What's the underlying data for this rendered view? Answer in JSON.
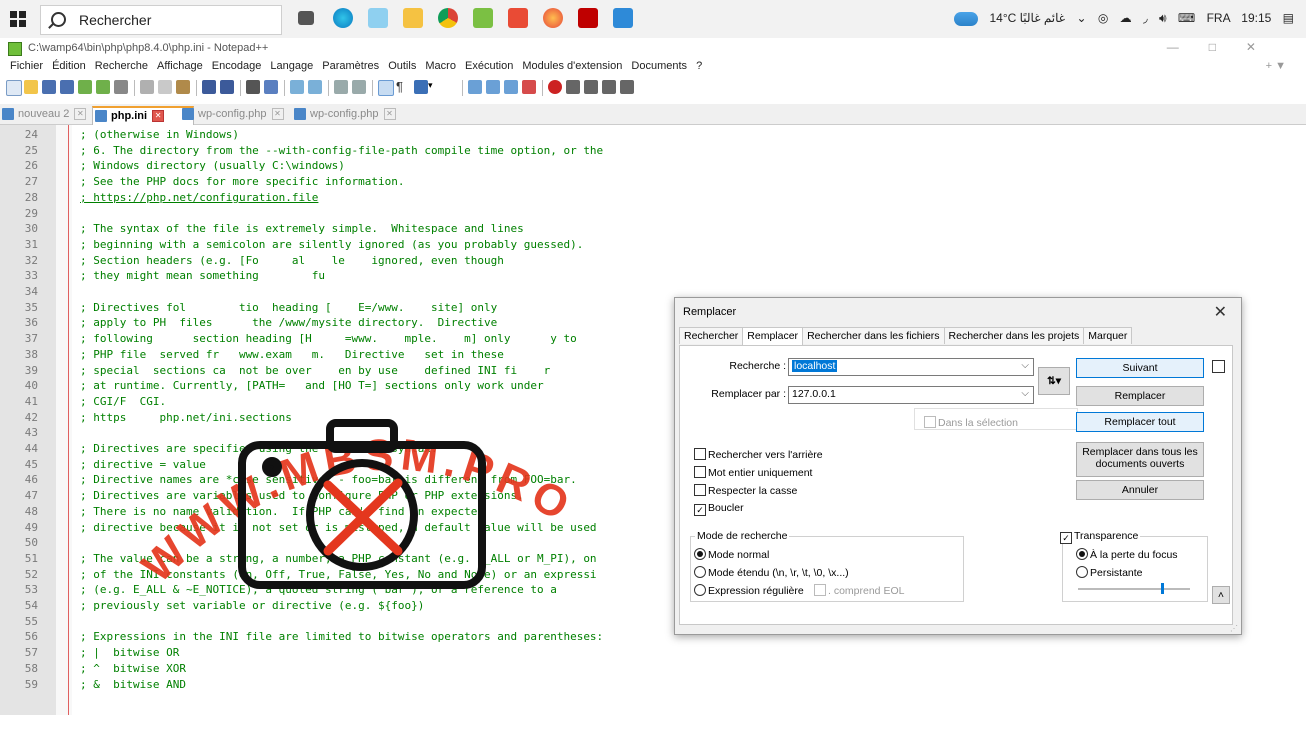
{
  "taskbar": {
    "search_placeholder": "Rechercher",
    "weather": "14°C غائم غالبًا",
    "language": "FRA",
    "time": "19:15"
  },
  "window": {
    "title": "C:\\wamp64\\bin\\php\\php8.4.0\\php.ini - Notepad++"
  },
  "menu": {
    "items": [
      "Fichier",
      "Édition",
      "Recherche",
      "Affichage",
      "Encodage",
      "Langage",
      "Paramètres",
      "Outils",
      "Macro",
      "Exécution",
      "Modules d'extension",
      "Documents",
      "?"
    ],
    "right": "+ ▼"
  },
  "tabs": [
    {
      "label": "nouveau 2"
    },
    {
      "label": "php.ini"
    },
    {
      "label": "wp-config.php"
    },
    {
      "label": "wp-config.php"
    }
  ],
  "editor": {
    "lines": [
      {
        "n": "24",
        "text": "; (otherwise in Windows)"
      },
      {
        "n": "25",
        "text": "; 6. The directory from the --with-config-file-path compile time option, or the"
      },
      {
        "n": "26",
        "text": "; Windows directory (usually C:\\windows)"
      },
      {
        "n": "27",
        "text": "; See the PHP docs for more specific information."
      },
      {
        "n": "28",
        "text": "; https://php.net/configuration.file"
      },
      {
        "n": "29",
        "text": ""
      },
      {
        "n": "30",
        "text": "; The syntax of the file is extremely simple.  Whitespace and lines"
      },
      {
        "n": "31",
        "text": "; beginning with a semicolon are silently ignored (as you probably guessed)."
      },
      {
        "n": "32",
        "text": "; Section headers (e.g. [Fo     al    le    ignored, even though"
      },
      {
        "n": "33",
        "text": "; they might mean something        fu"
      },
      {
        "n": "34",
        "text": ""
      },
      {
        "n": "35",
        "text": "; Directives fol        tio  heading [    E=/www.    site] only"
      },
      {
        "n": "36",
        "text": "; apply to PH  files      the /www/mysite directory.  Directive"
      },
      {
        "n": "37",
        "text": "; following      section heading [H     =www.    mple.    m] only      y to"
      },
      {
        "n": "38",
        "text": "; PHP file  served fr   www.exam   m.   Directive   set in these"
      },
      {
        "n": "39",
        "text": "; special  sections ca  not be over    en by use    defined INI fi    r"
      },
      {
        "n": "40",
        "text": "; at runtime. Currently, [PATH=   and [HO T=] sections only work under"
      },
      {
        "n": "41",
        "text": "; CGI/F  CGI."
      },
      {
        "n": "42",
        "text": "; https     php.net/ini.sections"
      },
      {
        "n": "43",
        "text": ""
      },
      {
        "n": "44",
        "text": "; Directives are specified using the following syntax:"
      },
      {
        "n": "45",
        "text": "; directive = value"
      },
      {
        "n": "46",
        "text": "; Directive names are *case sensitive* - foo=bar is different from FOO=bar."
      },
      {
        "n": "47",
        "text": "; Directives are variables used to configure PHP or PHP extensions."
      },
      {
        "n": "48",
        "text": "; There is no name validation.  If PHP can't find an expected"
      },
      {
        "n": "49",
        "text": "; directive because it is not set or is mistyped, a default value will be used"
      },
      {
        "n": "50",
        "text": ""
      },
      {
        "n": "51",
        "text": "; The value can be a string, a number, a PHP constant (e.g. E_ALL or M_PI), on"
      },
      {
        "n": "52",
        "text": "; of the INI constants (On, Off, True, False, Yes, No and None) or an expressi"
      },
      {
        "n": "53",
        "text": "; (e.g. E_ALL & ~E_NOTICE), a quoted string (\"bar\"), or a reference to a"
      },
      {
        "n": "54",
        "text": "; previously set variable or directive (e.g. ${foo})"
      },
      {
        "n": "55",
        "text": ""
      },
      {
        "n": "56",
        "text": "; Expressions in the INI file are limited to bitwise operators and parentheses:"
      },
      {
        "n": "57",
        "text": "; |  bitwise OR"
      },
      {
        "n": "58",
        "text": "; ^  bitwise XOR"
      },
      {
        "n": "59",
        "text": "; &  bitwise AND"
      }
    ]
  },
  "watermark": {
    "text": "WWW.MBSM.PRO"
  },
  "dialog": {
    "title": "Remplacer",
    "tabs": [
      "Rechercher",
      "Remplacer",
      "Rechercher dans les fichiers",
      "Rechercher dans les projets",
      "Marquer"
    ],
    "find_label": "Recherche :",
    "find_value": "localhost",
    "replace_label": "Remplacer par :",
    "replace_value": "127.0.0.1",
    "swap_icon": "swap-arrows-icon",
    "in_selection": "Dans la sélection",
    "buttons": {
      "next": "Suivant",
      "replace": "Remplacer",
      "replace_all": "Remplacer tout",
      "replace_all_docs": "Remplacer dans tous les documents ouverts",
      "cancel": "Annuler"
    },
    "options": {
      "backward": {
        "label": "Rechercher vers l'arrière",
        "checked": false
      },
      "whole_word": {
        "label": "Mot entier uniquement",
        "checked": false
      },
      "match_case": {
        "label": "Respecter la casse",
        "checked": false
      },
      "wrap": {
        "label": "Boucler",
        "checked": true
      }
    },
    "search_mode": {
      "title": "Mode de recherche",
      "normal": "Mode normal",
      "extended": "Mode étendu (\\n, \\r, \\t, \\0, \\x...)",
      "regex": "Expression régulière",
      "dot_newline": ". comprend EOL",
      "selected": "normal"
    },
    "transparency": {
      "title": "Transparence",
      "enabled": true,
      "on_focus_loss": "À la perte du focus",
      "always": "Persistante",
      "selected": "on_focus_loss",
      "level": 0.75
    }
  },
  "colors": {
    "comment": "#008000",
    "accent": "#0078d7",
    "watermark": "#e4371e"
  }
}
